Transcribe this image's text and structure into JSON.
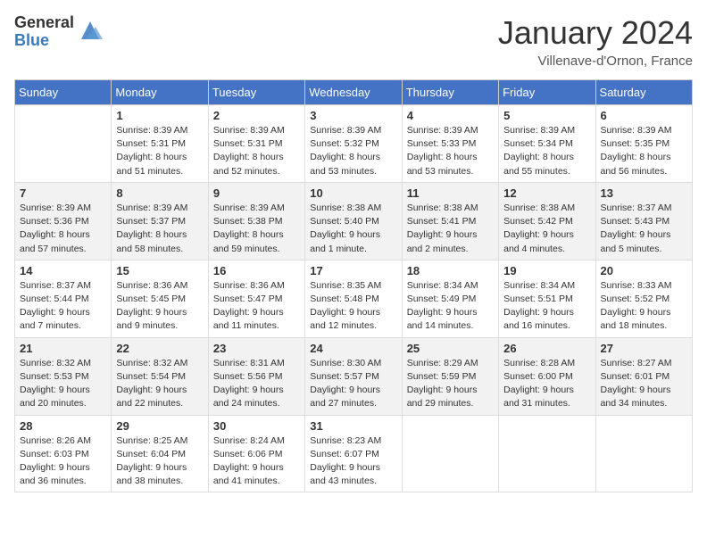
{
  "header": {
    "logo_general": "General",
    "logo_blue": "Blue",
    "month_title": "January 2024",
    "subtitle": "Villenave-d'Ornon, France"
  },
  "weekdays": [
    "Sunday",
    "Monday",
    "Tuesday",
    "Wednesday",
    "Thursday",
    "Friday",
    "Saturday"
  ],
  "weeks": [
    [
      {
        "day": "",
        "info": ""
      },
      {
        "day": "1",
        "info": "Sunrise: 8:39 AM\nSunset: 5:31 PM\nDaylight: 8 hours\nand 51 minutes."
      },
      {
        "day": "2",
        "info": "Sunrise: 8:39 AM\nSunset: 5:31 PM\nDaylight: 8 hours\nand 52 minutes."
      },
      {
        "day": "3",
        "info": "Sunrise: 8:39 AM\nSunset: 5:32 PM\nDaylight: 8 hours\nand 53 minutes."
      },
      {
        "day": "4",
        "info": "Sunrise: 8:39 AM\nSunset: 5:33 PM\nDaylight: 8 hours\nand 53 minutes."
      },
      {
        "day": "5",
        "info": "Sunrise: 8:39 AM\nSunset: 5:34 PM\nDaylight: 8 hours\nand 55 minutes."
      },
      {
        "day": "6",
        "info": "Sunrise: 8:39 AM\nSunset: 5:35 PM\nDaylight: 8 hours\nand 56 minutes."
      }
    ],
    [
      {
        "day": "7",
        "info": "Sunrise: 8:39 AM\nSunset: 5:36 PM\nDaylight: 8 hours\nand 57 minutes."
      },
      {
        "day": "8",
        "info": "Sunrise: 8:39 AM\nSunset: 5:37 PM\nDaylight: 8 hours\nand 58 minutes."
      },
      {
        "day": "9",
        "info": "Sunrise: 8:39 AM\nSunset: 5:38 PM\nDaylight: 8 hours\nand 59 minutes."
      },
      {
        "day": "10",
        "info": "Sunrise: 8:38 AM\nSunset: 5:40 PM\nDaylight: 9 hours\nand 1 minute."
      },
      {
        "day": "11",
        "info": "Sunrise: 8:38 AM\nSunset: 5:41 PM\nDaylight: 9 hours\nand 2 minutes."
      },
      {
        "day": "12",
        "info": "Sunrise: 8:38 AM\nSunset: 5:42 PM\nDaylight: 9 hours\nand 4 minutes."
      },
      {
        "day": "13",
        "info": "Sunrise: 8:37 AM\nSunset: 5:43 PM\nDaylight: 9 hours\nand 5 minutes."
      }
    ],
    [
      {
        "day": "14",
        "info": "Sunrise: 8:37 AM\nSunset: 5:44 PM\nDaylight: 9 hours\nand 7 minutes."
      },
      {
        "day": "15",
        "info": "Sunrise: 8:36 AM\nSunset: 5:45 PM\nDaylight: 9 hours\nand 9 minutes."
      },
      {
        "day": "16",
        "info": "Sunrise: 8:36 AM\nSunset: 5:47 PM\nDaylight: 9 hours\nand 11 minutes."
      },
      {
        "day": "17",
        "info": "Sunrise: 8:35 AM\nSunset: 5:48 PM\nDaylight: 9 hours\nand 12 minutes."
      },
      {
        "day": "18",
        "info": "Sunrise: 8:34 AM\nSunset: 5:49 PM\nDaylight: 9 hours\nand 14 minutes."
      },
      {
        "day": "19",
        "info": "Sunrise: 8:34 AM\nSunset: 5:51 PM\nDaylight: 9 hours\nand 16 minutes."
      },
      {
        "day": "20",
        "info": "Sunrise: 8:33 AM\nSunset: 5:52 PM\nDaylight: 9 hours\nand 18 minutes."
      }
    ],
    [
      {
        "day": "21",
        "info": "Sunrise: 8:32 AM\nSunset: 5:53 PM\nDaylight: 9 hours\nand 20 minutes."
      },
      {
        "day": "22",
        "info": "Sunrise: 8:32 AM\nSunset: 5:54 PM\nDaylight: 9 hours\nand 22 minutes."
      },
      {
        "day": "23",
        "info": "Sunrise: 8:31 AM\nSunset: 5:56 PM\nDaylight: 9 hours\nand 24 minutes."
      },
      {
        "day": "24",
        "info": "Sunrise: 8:30 AM\nSunset: 5:57 PM\nDaylight: 9 hours\nand 27 minutes."
      },
      {
        "day": "25",
        "info": "Sunrise: 8:29 AM\nSunset: 5:59 PM\nDaylight: 9 hours\nand 29 minutes."
      },
      {
        "day": "26",
        "info": "Sunrise: 8:28 AM\nSunset: 6:00 PM\nDaylight: 9 hours\nand 31 minutes."
      },
      {
        "day": "27",
        "info": "Sunrise: 8:27 AM\nSunset: 6:01 PM\nDaylight: 9 hours\nand 34 minutes."
      }
    ],
    [
      {
        "day": "28",
        "info": "Sunrise: 8:26 AM\nSunset: 6:03 PM\nDaylight: 9 hours\nand 36 minutes."
      },
      {
        "day": "29",
        "info": "Sunrise: 8:25 AM\nSunset: 6:04 PM\nDaylight: 9 hours\nand 38 minutes."
      },
      {
        "day": "30",
        "info": "Sunrise: 8:24 AM\nSunset: 6:06 PM\nDaylight: 9 hours\nand 41 minutes."
      },
      {
        "day": "31",
        "info": "Sunrise: 8:23 AM\nSunset: 6:07 PM\nDaylight: 9 hours\nand 43 minutes."
      },
      {
        "day": "",
        "info": ""
      },
      {
        "day": "",
        "info": ""
      },
      {
        "day": "",
        "info": ""
      }
    ]
  ]
}
